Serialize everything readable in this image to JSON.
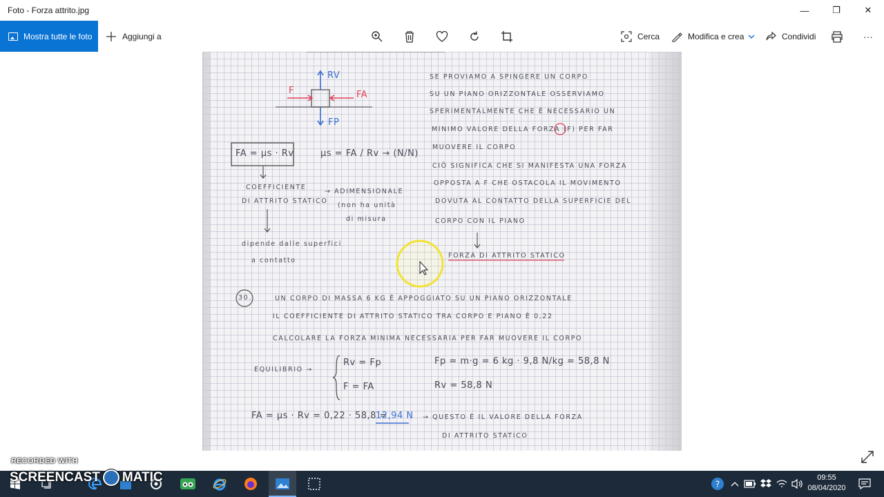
{
  "window": {
    "title": "Foto - Forza attrito.jpg",
    "minimize": "—",
    "maximize": "❐",
    "close": "✕"
  },
  "toolbar": {
    "show_all": "Mostra tutte le foto",
    "add_to": "Aggiungi a",
    "search": "Cerca",
    "edit_create": "Modifica e crea",
    "share": "Condividi",
    "more": "···"
  },
  "photo": {
    "diagram_labels": {
      "rv": "Rv",
      "f": "F",
      "fa": "FA",
      "fp": "Fp"
    },
    "formula_box": "FA = μs · Rv",
    "formula_mu": "μs = FA / Rv → (N/N)",
    "notes_right": [
      "se proviamo a spingere un corpo",
      "su un piano orizzontale osserviamo",
      "sperimentalmente che è necessario un",
      "minimo valore della forza (F) per far",
      "muovere il corpo",
      "ciò significa che si manifesta una forza",
      "opposta a F che ostacola il movimento",
      "dovuta al contatto della superficie del",
      "corpo con il piano"
    ],
    "static_friction": "forza di attrito statico",
    "coef_lines": [
      "coefficiente",
      "di attrito statico"
    ],
    "adim_lines": [
      "→ adimensionale",
      "(non ha unità",
      "di misura"
    ],
    "depends_lines": [
      "dipende dalle superfici",
      "a contatto"
    ],
    "exercise_number": "30.",
    "exercise_lines": [
      "un corpo di massa 6 kg è appoggiato su un piano orizzontale",
      "il coefficiente di attrito statico tra corpo e piano è 0,22",
      "calcolare la forza minima necessaria per far muovere il corpo"
    ],
    "equilibrio": "equilibrio →",
    "eq1": "Rv = Fp",
    "eq2": "F = FA",
    "fp_calc": "Fp = m·g = 6 kg · 9,8 N/kg = 58,8 N",
    "rv_calc": "Rv = 58,8 N",
    "fa_calc": "FA = μs · Rv = 0,22 · 58,8 =",
    "fa_result": "12,94 N",
    "conclusion_lines": [
      "→ questo è il valore della forza",
      "di attrito statico"
    ]
  },
  "watermark": {
    "recorded": "RECORDED WITH",
    "brand_left": "SCREENCAST",
    "brand_right": "MATIC"
  },
  "taskbar": {
    "time": "09:55",
    "date": "08/04/2020"
  },
  "colors": {
    "accent": "#0a74d4",
    "taskbar": "#1c2a3a",
    "ink_red": "#e0405a",
    "ink_blue": "#3b6fd0",
    "pencil": "#4a4a55"
  }
}
